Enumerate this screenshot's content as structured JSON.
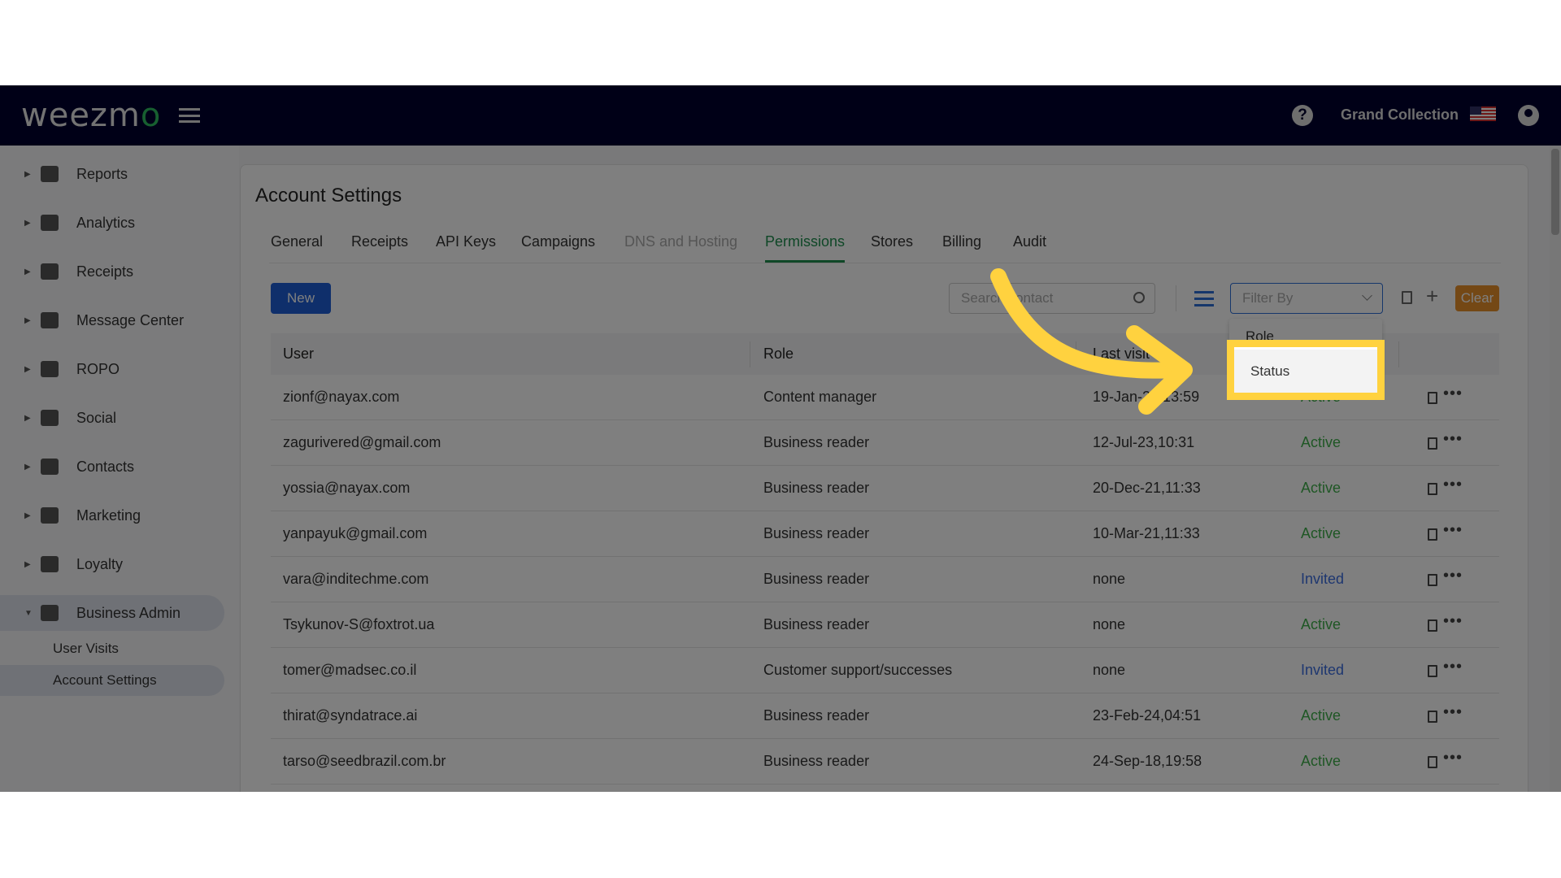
{
  "header": {
    "logo": "weezmo",
    "org_name": "Grand Collection",
    "icons": [
      "menu-icon",
      "help-icon",
      "us-flag-icon",
      "user-account-icon"
    ]
  },
  "sidebar": {
    "items": [
      {
        "label": "Reports",
        "icon": "dashboard-icon"
      },
      {
        "label": "Analytics",
        "icon": "bar-chart-icon"
      },
      {
        "label": "Receipts",
        "icon": "receipt-icon"
      },
      {
        "label": "Message Center",
        "icon": "chat-icon"
      },
      {
        "label": "ROPO",
        "icon": "infinity-icon"
      },
      {
        "label": "Social",
        "icon": "people-icon"
      },
      {
        "label": "Contacts",
        "icon": "contacts-icon"
      },
      {
        "label": "Marketing",
        "icon": "megaphone-icon"
      },
      {
        "label": "Loyalty",
        "icon": "tag-icon"
      },
      {
        "label": "Business Admin",
        "icon": "gear-icon",
        "expanded": true
      }
    ],
    "subitems": [
      {
        "label": "User Visits"
      },
      {
        "label": "Account Settings",
        "active": true
      }
    ]
  },
  "page": {
    "title": "Account Settings",
    "tabs": [
      {
        "label": "General"
      },
      {
        "label": "Receipts"
      },
      {
        "label": "API Keys"
      },
      {
        "label": "Campaigns"
      },
      {
        "label": "DNS and Hosting",
        "disabled": true
      },
      {
        "label": "Permissions",
        "active": true
      },
      {
        "label": "Stores"
      },
      {
        "label": "Billing"
      },
      {
        "label": "Audit"
      }
    ],
    "toolbar": {
      "new_label": "New",
      "search_placeholder": "Search contact",
      "filter_placeholder": "Filter By",
      "clear_label": "Clear"
    },
    "dropdown": {
      "options": [
        "Role",
        "Status"
      ],
      "highlighted": "Status"
    },
    "table": {
      "columns": [
        "User",
        "Role",
        "Last visit"
      ],
      "rows": [
        {
          "user": "zionf@nayax.com",
          "role": "Content manager",
          "last_visit": "19-Jan-24,13:59",
          "status": "Active"
        },
        {
          "user": "zagurivered@gmail.com",
          "role": "Business reader",
          "last_visit": "12-Jul-23,10:31",
          "status": "Active"
        },
        {
          "user": "yossia@nayax.com",
          "role": "Business reader",
          "last_visit": "20-Dec-21,11:33",
          "status": "Active"
        },
        {
          "user": "yanpayuk@gmail.com",
          "role": "Business reader",
          "last_visit": "10-Mar-21,11:33",
          "status": "Active"
        },
        {
          "user": "vara@inditechme.com",
          "role": "Business reader",
          "last_visit": "none",
          "status": "Invited"
        },
        {
          "user": "Tsykunov-S@foxtrot.ua",
          "role": "Business reader",
          "last_visit": "none",
          "status": "Active"
        },
        {
          "user": "tomer@madsec.co.il",
          "role": "Customer support/successes",
          "last_visit": "none",
          "status": "Invited"
        },
        {
          "user": "thirat@syndatrace.ai",
          "role": "Business reader",
          "last_visit": "23-Feb-24,04:51",
          "status": "Active"
        },
        {
          "user": "tarso@seedbrazil.com.br",
          "role": "Business reader",
          "last_visit": "24-Sep-18,19:58",
          "status": "Active"
        }
      ]
    }
  },
  "colors": {
    "nav": "#00002e",
    "accent": "#1f8f4e",
    "primary": "#1e5fd6",
    "clear": "#e8902a",
    "active": "#3fae4a",
    "invited": "#3d6ee0",
    "highlight": "#ffd23f"
  }
}
